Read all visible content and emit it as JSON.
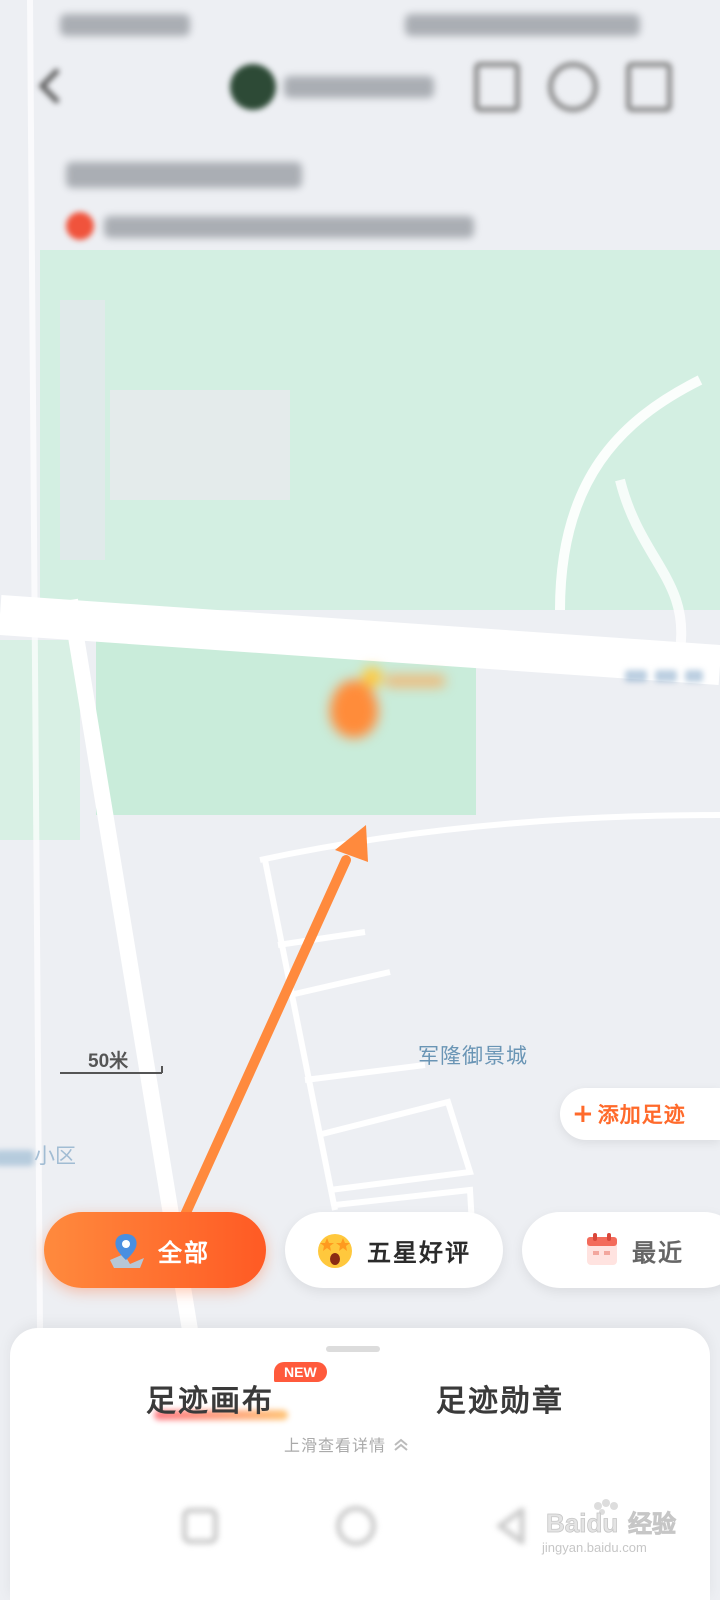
{
  "map": {
    "scale_label": "50米",
    "place_label_primary": "军隆御景城",
    "place_label_secondary": "小区",
    "add_footprint_label": "添加足迹"
  },
  "filter_chips": [
    {
      "label": "全部",
      "icon": "map-pin-icon",
      "active": true
    },
    {
      "label": "五星好评",
      "icon": "star-eyes-emoji-icon",
      "active": false
    },
    {
      "label": "最近",
      "icon": "calendar-icon",
      "active": false
    }
  ],
  "bottom_sheet": {
    "tabs": [
      {
        "label": "足迹画布",
        "badge": "NEW"
      },
      {
        "label": "足迹勋章"
      }
    ],
    "hint": "上滑查看详情"
  },
  "colors": {
    "accent": "#ff6a2b",
    "accent_light": "#ff8a3d",
    "map_green": "#cfeee0",
    "map_gray": "#edeff3",
    "place_label": "#6a95b5"
  },
  "watermark": "Baidu经验 jingyan.baidu.com"
}
